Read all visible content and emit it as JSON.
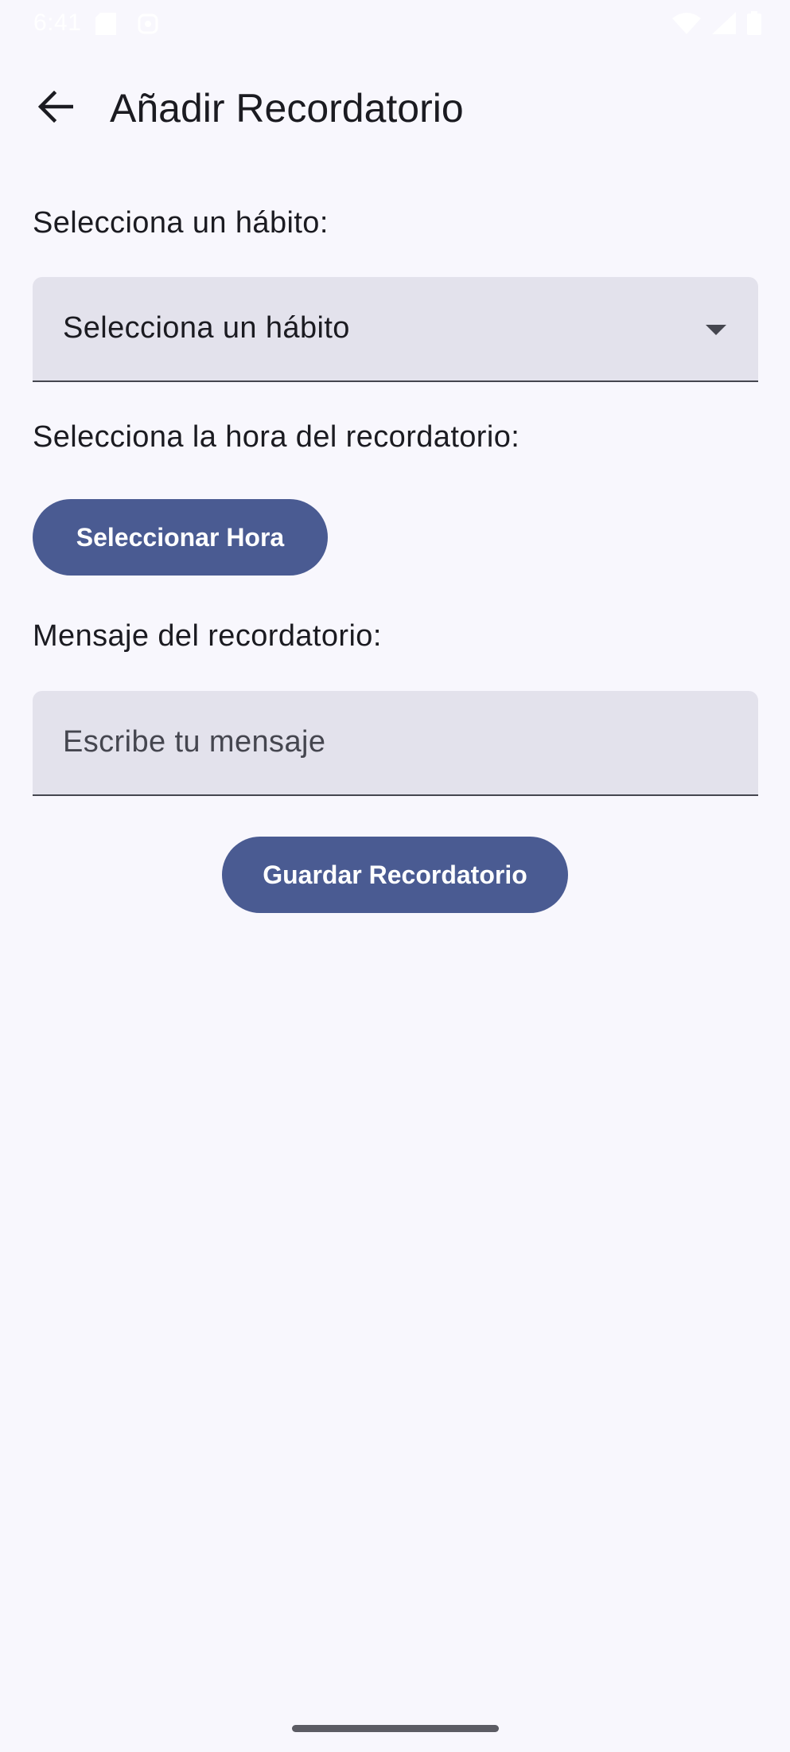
{
  "status_bar": {
    "time": "6:41",
    "icons": [
      "sim-card-icon",
      "sync-icon",
      "wifi-icon",
      "signal-icon",
      "battery-icon"
    ]
  },
  "top_bar": {
    "back_icon": "arrow-back-icon",
    "title": "Añadir Recordatorio"
  },
  "habit_section": {
    "label": "Selecciona un hábito:",
    "dropdown_value": "Selecciona un hábito",
    "dropdown_icon": "arrow-drop-down-icon"
  },
  "time_section": {
    "label": "Selecciona la hora del recordatorio:",
    "button_label": "Seleccionar Hora"
  },
  "message_section": {
    "label": "Mensaje del recordatorio:",
    "placeholder": "Escribe tu mensaje"
  },
  "save_button_label": "Guardar Recordatorio",
  "colors": {
    "background": "#f8f7fd",
    "field_fill": "#e3e2ec",
    "primary": "#4a5b92",
    "on_surface": "#1b1b21"
  }
}
